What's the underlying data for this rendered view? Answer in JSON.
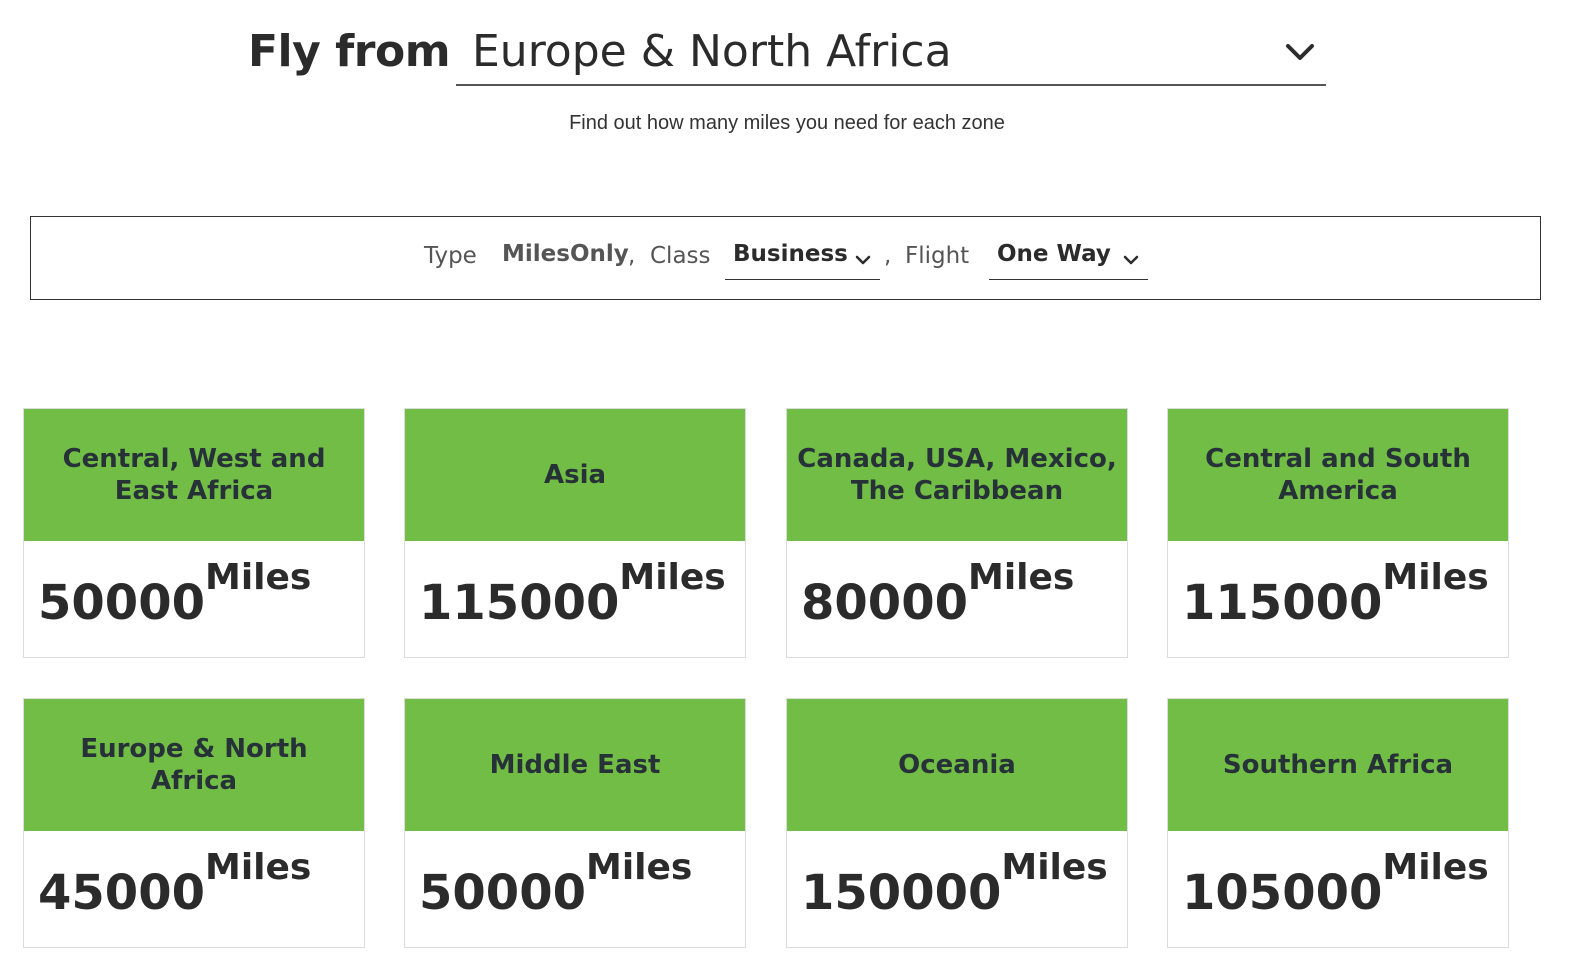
{
  "fly_from": {
    "label": "Fly from",
    "selected": "Europe & North Africa"
  },
  "subtitle": "Find out how many miles you need for each zone",
  "filters": {
    "type_label": "Type",
    "type_value": "MilesOnly",
    "comma1": ",",
    "class_label": "Class",
    "class_value": "Business",
    "comma2": ",",
    "flight_label": "Flight",
    "flight_value": "One Way"
  },
  "zones": [
    {
      "name": "Central, West and East Africa",
      "miles": "50000",
      "unit": "Miles"
    },
    {
      "name": "Asia",
      "miles": "115000",
      "unit": "Miles"
    },
    {
      "name": "Canada, USA, Mexico, The Caribbean",
      "miles": "80000",
      "unit": "Miles"
    },
    {
      "name": "Central and South America",
      "miles": "115000",
      "unit": "Miles"
    },
    {
      "name": "Europe & North Africa",
      "miles": "45000",
      "unit": "Miles"
    },
    {
      "name": "Middle East",
      "miles": "50000",
      "unit": "Miles"
    },
    {
      "name": "Oceania",
      "miles": "150000",
      "unit": "Miles"
    },
    {
      "name": "Southern Africa",
      "miles": "105000",
      "unit": "Miles"
    }
  ],
  "colors": {
    "zone_header": "#72bd45",
    "text": "#2b2b2b"
  },
  "icons": {
    "dropdown": "chevron-down-icon"
  }
}
